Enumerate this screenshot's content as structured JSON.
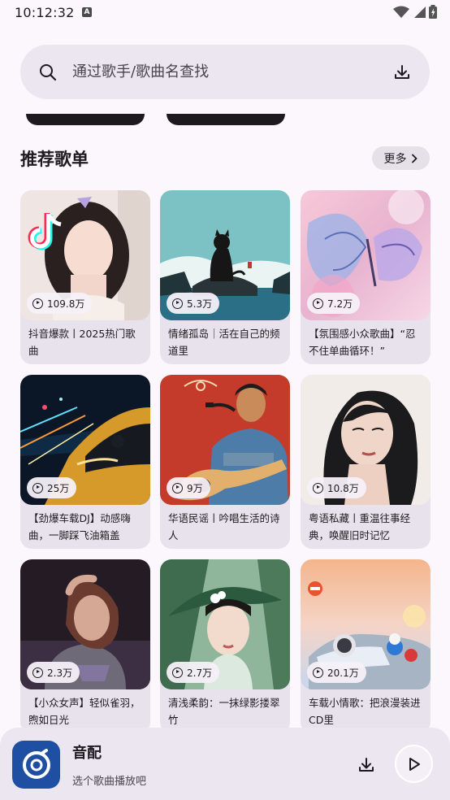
{
  "status": {
    "time": "10:12:32",
    "badge": "A"
  },
  "search": {
    "placeholder": "通过歌手/歌曲名查找"
  },
  "section": {
    "title": "推荐歌单",
    "more": "更多"
  },
  "playlists": [
    {
      "plays": "109.8万",
      "name": "抖音爆款丨2025热门歌曲"
    },
    {
      "plays": "5.3万",
      "name": "情绪孤岛｜活在自己的频道里"
    },
    {
      "plays": "7.2万",
      "name": "【氛围感小众歌曲】“忍不住单曲循环！”"
    },
    {
      "plays": "25万",
      "name": "【劲爆车载DJ】动感嗨曲，一脚踩飞油箱盖"
    },
    {
      "plays": "9万",
      "name": "华语民谣丨吟唱生活的诗人"
    },
    {
      "plays": "10.8万",
      "name": "粤语私藏丨重温往事经典，唤醒旧时记忆"
    },
    {
      "plays": "2.3万",
      "name": "【小众女声】轻似雀羽，煦如日光"
    },
    {
      "plays": "2.7万",
      "name": "清浅柔韵：一抹绿影搂翠竹"
    },
    {
      "plays": "20.1万",
      "name": "车载小情歌：把浪漫装进CD里"
    }
  ],
  "player": {
    "title": "音配",
    "subtitle": "选个歌曲播放吧"
  },
  "colors": {
    "background": "#fbf7fc",
    "surface": "#ece6f0",
    "logo": "#1f4fa2"
  }
}
